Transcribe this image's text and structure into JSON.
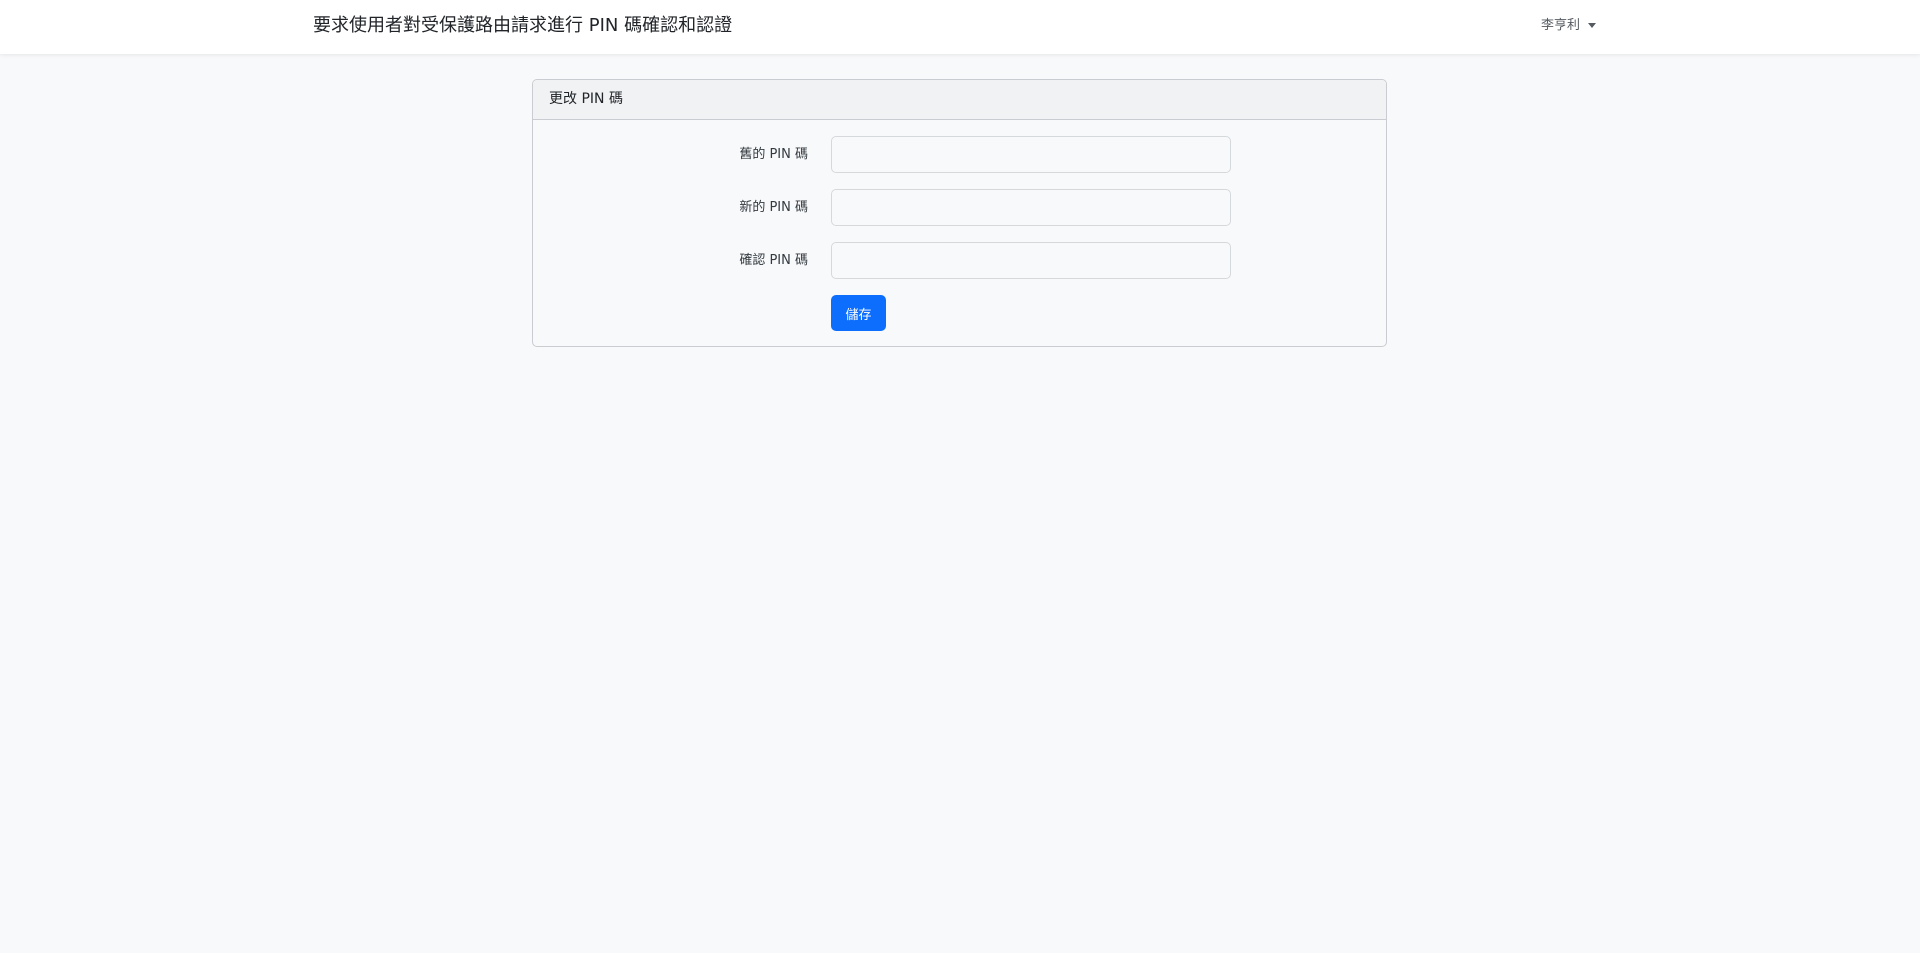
{
  "navbar": {
    "brand": "要求使用者對受保護路由請求進行 PIN 碼確認和認證",
    "user_name": "李亨利"
  },
  "card": {
    "title": "更改 PIN 碼",
    "fields": [
      {
        "label": "舊的 PIN 碼",
        "value": "",
        "placeholder": ""
      },
      {
        "label": "新的 PIN 碼",
        "value": "",
        "placeholder": ""
      },
      {
        "label": "確認 PIN 碼",
        "value": "",
        "placeholder": ""
      }
    ],
    "save_label": "儲存"
  },
  "colors": {
    "primary": "#0d6efd",
    "background": "#f8f9fa",
    "navbar": "#ffffff"
  },
  "icons": {
    "user_menu": "caret-down-icon"
  }
}
